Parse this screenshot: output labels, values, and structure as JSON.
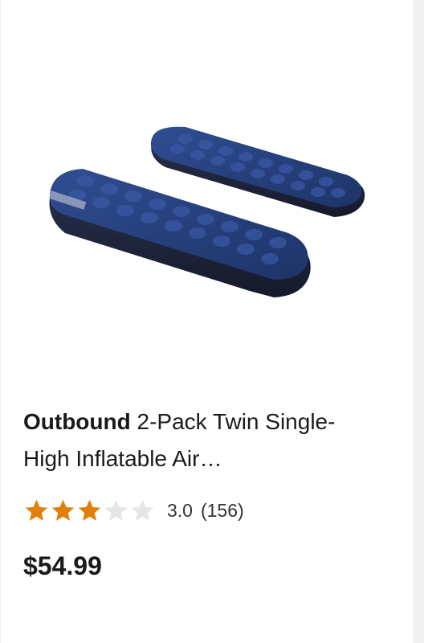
{
  "product": {
    "image_alt": "2-Pack Twin Single-High Inflatable Air Mattress",
    "brand": "Outbound",
    "name": " 2-Pack Twin Single-High Inflatable Air…",
    "rating": {
      "value": "3.0",
      "count": "(156)",
      "stars_filled": 3,
      "stars_total": 5
    },
    "price": "$54.99"
  },
  "colors": {
    "star_filled": "#e07f0a",
    "star_empty": "#e6e6e6",
    "mattress_navy": "#263d7a"
  },
  "icons": {
    "star": "star-icon"
  }
}
